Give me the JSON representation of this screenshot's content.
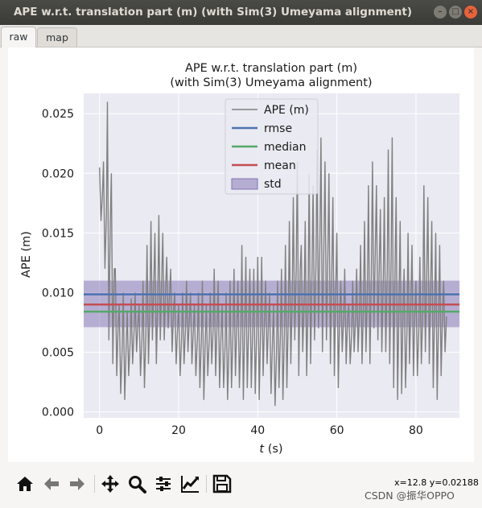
{
  "window": {
    "title": "APE w.r.t. translation part (m) (with Sim(3) Umeyama alignment)"
  },
  "tabs": [
    {
      "label": "raw"
    },
    {
      "label": "map"
    }
  ],
  "chart_data": {
    "type": "line",
    "title": [
      "APE w.r.t. translation part (m)",
      "(with Sim(3) Umeyama alignment)"
    ],
    "xlabel": "t (s)",
    "ylabel": "APE (m)",
    "xlim": [
      -4,
      91
    ],
    "ylim": [
      -0.0005,
      0.0267
    ],
    "xticks": [
      0,
      20,
      40,
      60,
      80
    ],
    "xtick_labels": [
      "0",
      "20",
      "40",
      "60",
      "80"
    ],
    "yticks": [
      0.0,
      0.005,
      0.01,
      0.015,
      0.02,
      0.025
    ],
    "ytick_labels": [
      "0.000",
      "0.005",
      "0.010",
      "0.015",
      "0.020",
      "0.025"
    ],
    "grid": true,
    "legend_position": "top-center",
    "series": [
      {
        "name": "APE (m)",
        "color": "#808080",
        "x": [
          0,
          1,
          2,
          3,
          4,
          5,
          6,
          7,
          8,
          9,
          10,
          11,
          12,
          13,
          14,
          15,
          16,
          17,
          18,
          19,
          20,
          21,
          22,
          23,
          24,
          25,
          26,
          27,
          28,
          29,
          30,
          31,
          32,
          33,
          34,
          35,
          36,
          37,
          38,
          39,
          40,
          41,
          42,
          43,
          44,
          45,
          46,
          47,
          48,
          49,
          50,
          51,
          52,
          53,
          54,
          55,
          56,
          57,
          58,
          59,
          60,
          61,
          62,
          63,
          64,
          65,
          66,
          67,
          68,
          69,
          70,
          71,
          72,
          73,
          74,
          75,
          76,
          77,
          78,
          79,
          80,
          81,
          82,
          83,
          84,
          85,
          86,
          87
        ],
        "ymin": [
          0.016,
          0.012,
          0.006,
          0.004,
          0.003,
          0.0015,
          0.001,
          0.003,
          0.004,
          0.005,
          0.003,
          0.002,
          0.004,
          0.006,
          0.004,
          0.006,
          0.006,
          0.007,
          0.005,
          0.004,
          0.003,
          0.004,
          0.005,
          0.004,
          0.003,
          0.002,
          0.001,
          0.003,
          0.004,
          0.003,
          0.002,
          0.002,
          0.001,
          0.002,
          0.003,
          0.002,
          0.001,
          0.002,
          0.002,
          0.0015,
          0.001,
          0.003,
          0.004,
          0.0015,
          0.0005,
          0.002,
          0.001,
          0.002,
          0.004,
          0.006,
          0.003,
          0.005,
          0.003,
          0.004,
          0.006,
          0.007,
          0.005,
          0.006,
          0.004,
          0.003,
          0.002,
          0.005,
          0.004,
          0.004,
          0.005,
          0.005,
          0.004,
          0.005,
          0.004,
          0.007,
          0.006,
          0.005,
          0.005,
          0.004,
          0.002,
          0.001,
          0.0015,
          0.002,
          0.004,
          0.003,
          0.003,
          0.004,
          0.005,
          0.004,
          0.002,
          0.001,
          0.003,
          0.005
        ],
        "ymax": [
          0.0205,
          0.021,
          0.026,
          0.02,
          0.012,
          0.009,
          0.01,
          0.0085,
          0.0095,
          0.01,
          0.009,
          0.011,
          0.014,
          0.016,
          0.015,
          0.0165,
          0.015,
          0.013,
          0.012,
          0.01,
          0.009,
          0.01,
          0.011,
          0.01,
          0.009,
          0.01,
          0.011,
          0.009,
          0.01,
          0.012,
          0.011,
          0.009,
          0.01,
          0.011,
          0.012,
          0.011,
          0.014,
          0.013,
          0.012,
          0.012,
          0.013,
          0.013,
          0.011,
          0.01,
          0.009,
          0.011,
          0.012,
          0.014,
          0.016,
          0.018,
          0.021,
          0.014,
          0.016,
          0.02,
          0.019,
          0.022,
          0.023,
          0.021,
          0.02,
          0.018,
          0.015,
          0.011,
          0.012,
          0.009,
          0.011,
          0.012,
          0.014,
          0.016,
          0.019,
          0.021,
          0.019,
          0.017,
          0.018,
          0.022,
          0.023,
          0.018,
          0.016,
          0.012,
          0.015,
          0.014,
          0.011,
          0.013,
          0.019,
          0.018,
          0.016,
          0.015,
          0.014,
          0.011
        ]
      },
      {
        "name": "rmse",
        "color": "#4c72b0",
        "value": 0.00985
      },
      {
        "name": "median",
        "color": "#55a868",
        "value": 0.0084
      },
      {
        "name": "mean",
        "color": "#c44e52",
        "value": 0.009
      },
      {
        "name": "std",
        "color": "#8172b2",
        "range": [
          0.0071,
          0.011
        ]
      }
    ]
  },
  "toolbar": {
    "items": [
      {
        "name": "home-icon"
      },
      {
        "name": "back-icon"
      },
      {
        "name": "forward-icon"
      },
      {
        "name": "pan-icon"
      },
      {
        "name": "zoom-icon"
      },
      {
        "name": "configure-subplots-icon"
      },
      {
        "name": "edit-axis-icon"
      },
      {
        "name": "save-icon"
      }
    ],
    "coordinates": "x=12.8 y=0.02188"
  },
  "watermark": "CSDN @振华OPPO"
}
